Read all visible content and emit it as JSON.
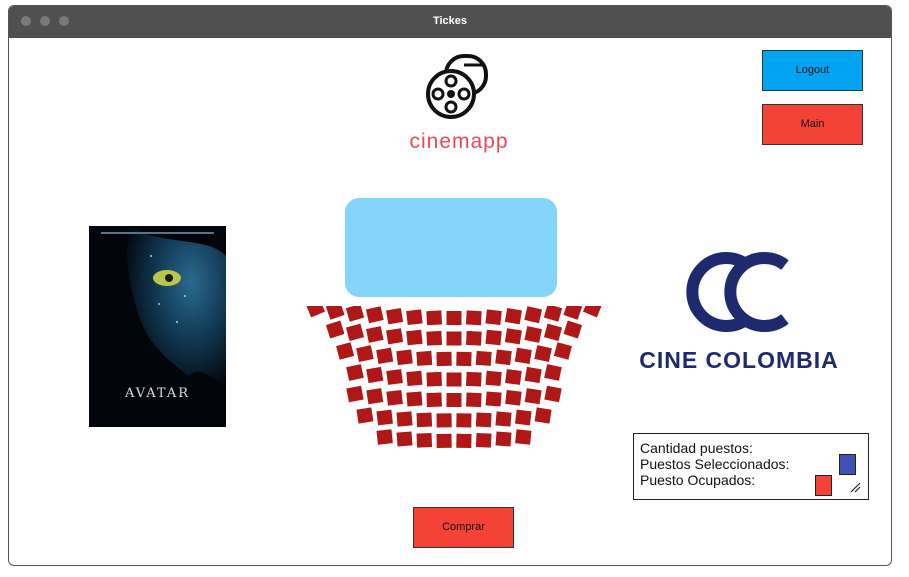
{
  "window": {
    "title": "Tickes"
  },
  "header": {
    "logo_text": "cinemapp"
  },
  "buttons": {
    "logout": "Logout",
    "main": "Main",
    "comprar": "Comprar"
  },
  "poster": {
    "title": "AVATAR"
  },
  "brand": {
    "name": "CINE COLOMBIA"
  },
  "legend": {
    "cantidad": "Cantidad puestos:",
    "seleccionados": "Puestos Seleccionados:",
    "ocupados": "Puesto Ocupados:"
  },
  "colors": {
    "seat": "#b01818",
    "selected": "#3f51b5",
    "occupied": "#f44336",
    "screen": "#84d4fc",
    "accent_blue": "#00a4f0"
  },
  "seating": {
    "row_counts": [
      15,
      13,
      12,
      11,
      11,
      10,
      8
    ]
  }
}
